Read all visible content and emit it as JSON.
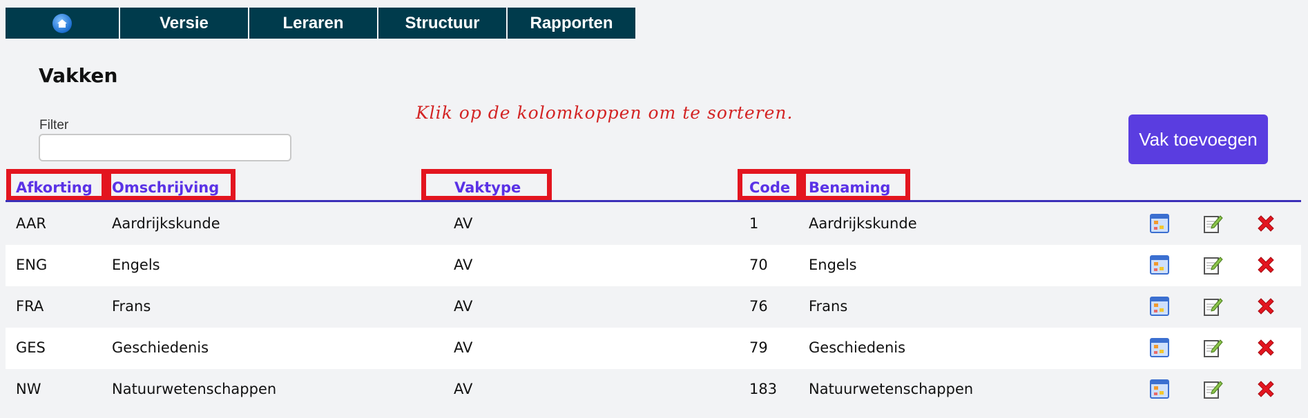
{
  "nav": {
    "home_icon": "home-icon",
    "items": [
      {
        "label": "Versie"
      },
      {
        "label": "Leraren"
      },
      {
        "label": "Structuur"
      },
      {
        "label": "Rapporten"
      }
    ]
  },
  "page": {
    "title": "Vakken",
    "hint": "Klik op de kolomkoppen om te sorteren.",
    "filter_label": "Filter",
    "filter_value": "",
    "add_button": "Vak toevoegen"
  },
  "table": {
    "headers": {
      "afkorting": "Afkorting",
      "omschrijving": "Omschrijving",
      "vaktype": "Vaktype",
      "code": "Code",
      "benaming": "Benaming"
    },
    "rows": [
      {
        "afkorting": "AAR",
        "omschrijving": "Aardrijkskunde",
        "vaktype": "AV",
        "code": "1",
        "benaming": "Aardrijkskunde"
      },
      {
        "afkorting": "ENG",
        "omschrijving": "Engels",
        "vaktype": "AV",
        "code": "70",
        "benaming": "Engels"
      },
      {
        "afkorting": "FRA",
        "omschrijving": "Frans",
        "vaktype": "AV",
        "code": "76",
        "benaming": "Frans"
      },
      {
        "afkorting": "GES",
        "omschrijving": "Geschiedenis",
        "vaktype": "AV",
        "code": "79",
        "benaming": "Geschiedenis"
      },
      {
        "afkorting": "NW",
        "omschrijving": "Natuurwetenschappen",
        "vaktype": "AV",
        "code": "183",
        "benaming": "Natuurwetenschappen"
      }
    ],
    "row_actions": [
      "structure-icon",
      "edit-icon",
      "delete-icon"
    ]
  },
  "colors": {
    "nav_bg": "#003b4c",
    "accent": "#5a3de0",
    "header_link": "#5a32e6",
    "highlight_box": "#e3151f",
    "hint": "#d32424"
  }
}
